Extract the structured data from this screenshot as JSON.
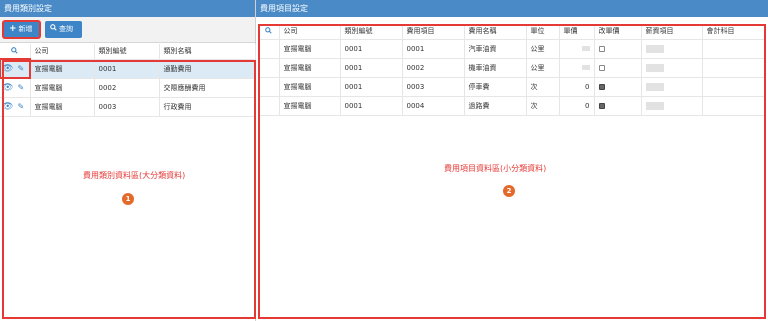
{
  "category_panel": {
    "title": "費用類別設定",
    "toolbar": {
      "add_label": "新增",
      "add_icon": "plus-icon",
      "query_label": "查詢",
      "query_icon": "search-icon"
    },
    "columns": [
      "公司",
      "類別編號",
      "類別名稱"
    ],
    "rows": [
      {
        "company": "宣揚電腦",
        "code": "0001",
        "name": "通勤費用"
      },
      {
        "company": "宣揚電腦",
        "code": "0002",
        "name": "交際應酬費用"
      },
      {
        "company": "宣揚電腦",
        "code": "0003",
        "name": "行政費用"
      }
    ],
    "annotation": "費用類別資料區(大分類資料)",
    "badge": "1"
  },
  "item_panel": {
    "title": "費用項目設定",
    "columns": [
      "公司",
      "類別編號",
      "費用項目",
      "費用名稱",
      "單位",
      "單價",
      "改單價",
      "薪資項目",
      "會計科目"
    ],
    "rows": [
      {
        "company": "宣揚電腦",
        "category": "0001",
        "item": "0001",
        "name": "汽車油資",
        "unit": "公里",
        "price": "",
        "editable": false
      },
      {
        "company": "宣揚電腦",
        "category": "0001",
        "item": "0002",
        "name": "機車油資",
        "unit": "公里",
        "price": "",
        "editable": false
      },
      {
        "company": "宣揚電腦",
        "category": "0001",
        "item": "0003",
        "name": "停車費",
        "unit": "次",
        "price": "0",
        "editable": true
      },
      {
        "company": "宣揚電腦",
        "category": "0001",
        "item": "0004",
        "name": "過路費",
        "unit": "次",
        "price": "0",
        "editable": true
      }
    ],
    "annotation": "費用項目資料區(小分類資料)",
    "badge": "2"
  },
  "colors": {
    "header": "#4a8bc7",
    "button": "#3d85c6",
    "selected_row": "#dbeaf5",
    "annotation": "#e53935",
    "badge": "#e46a2b"
  }
}
